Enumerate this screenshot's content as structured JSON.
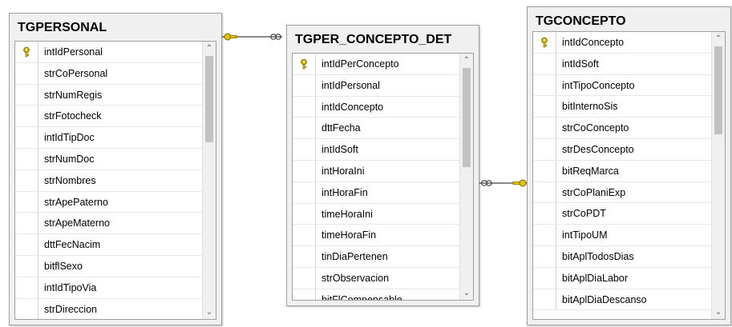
{
  "tables": [
    {
      "id": "personal",
      "title": "TGPERSONAL",
      "key_field_index": 0,
      "fields": [
        "intIdPersonal",
        "strCoPersonal",
        "strNumRegis",
        "strFotocheck",
        "intIdTipDoc",
        "strNumDoc",
        "strNombres",
        "strApePaterno",
        "strApeMaterno",
        "dttFecNacim",
        "bitflSexo",
        "intIdTipoVia",
        "strDireccion"
      ]
    },
    {
      "id": "det",
      "title": "TGPER_CONCEPTO_DET",
      "key_field_index": 0,
      "fields": [
        "intIdPerConcepto",
        "intIdPersonal",
        "intIdConcepto",
        "dttFecha",
        "intIdSoft",
        "intHoraIni",
        "intHoraFin",
        "timeHoraIni",
        "timeHoraFin",
        "tinDiaPertenen",
        "strObservacion",
        "bitFlCompensable"
      ]
    },
    {
      "id": "concepto",
      "title": "TGCONCEPTO",
      "key_field_index": 0,
      "fields": [
        "intIdConcepto",
        "intIdSoft",
        "intTipoConcepto",
        "bitInternoSis",
        "strCoConcepto",
        "strDesConcepto",
        "bitReqMarca",
        "strCoPlaniExp",
        "strCoPDT",
        "intTipoUM",
        "bitAplTodosDias",
        "bitAplDiaLabor",
        "bitAplDiaDescanso"
      ]
    }
  ],
  "colors": {
    "key_icon": "#e6c200",
    "connector": "#404040",
    "background": "#ffffff",
    "panel": "#f0f0f0"
  },
  "icons": {
    "key": "key-icon",
    "scroll_up": "chevron-up-icon",
    "scroll_down": "chevron-down-icon",
    "relationship_one": "key-endpoint-icon",
    "relationship_many": "infinity-endpoint-icon"
  }
}
